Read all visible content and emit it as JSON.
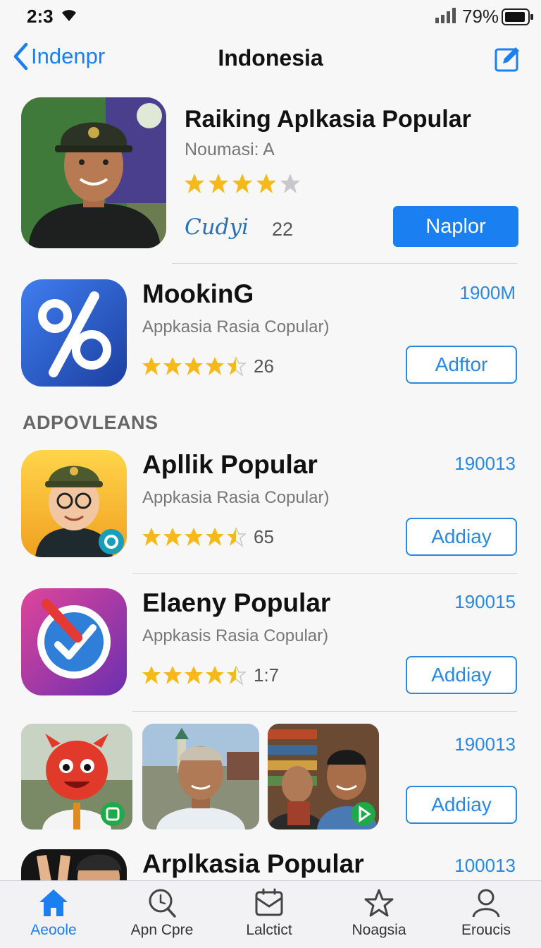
{
  "status_bar": {
    "time": "2:3",
    "battery_percent": "79%"
  },
  "nav": {
    "back_label": "Indenpr",
    "title": "Indonesia"
  },
  "featured": {
    "title": "Raiking Aplkasia Popular",
    "subtitle": "Noumasi: A",
    "rating_stars": 4,
    "signature": "Cudyi",
    "count": "22",
    "button_label": "Naplor"
  },
  "apps": [
    {
      "name": "MookinG",
      "description": "Appkasia Rasia Copular)",
      "rating_stars": 4.5,
      "rating_count": "26",
      "size": "1900M",
      "button_label": "Adftor"
    },
    {
      "name": "Apllik Popular",
      "description": "Appkasia Rasia Copular)",
      "rating_stars": 4.5,
      "rating_count": "65",
      "size": "190013",
      "button_label": "Addiay"
    },
    {
      "name": "Elaeny Popular",
      "description": "Appkasis Rasia Copular)",
      "rating_stars": 4.5,
      "rating_count": "1:7",
      "size": "190015",
      "button_label": "Addiay"
    }
  ],
  "section_header": "ADPOVLEANS",
  "screenshot_row": {
    "size": "190013",
    "button_label": "Addiay"
  },
  "partial_app": {
    "name": "Arplkasia Popular",
    "size": "100013"
  },
  "tabs": [
    {
      "label": "Aeoole",
      "icon": "home-icon",
      "active": true
    },
    {
      "label": "Apn Cpre",
      "icon": "search-icon",
      "active": false
    },
    {
      "label": "Lalctict",
      "icon": "inbox-icon",
      "active": false
    },
    {
      "label": "Noagsia",
      "icon": "star-icon",
      "active": false
    },
    {
      "label": "Eroucis",
      "icon": "person-icon",
      "active": false
    }
  ],
  "colors": {
    "accent": "#1a7ff0",
    "star": "#f5b91a",
    "star_empty": "#c8c8cc"
  }
}
